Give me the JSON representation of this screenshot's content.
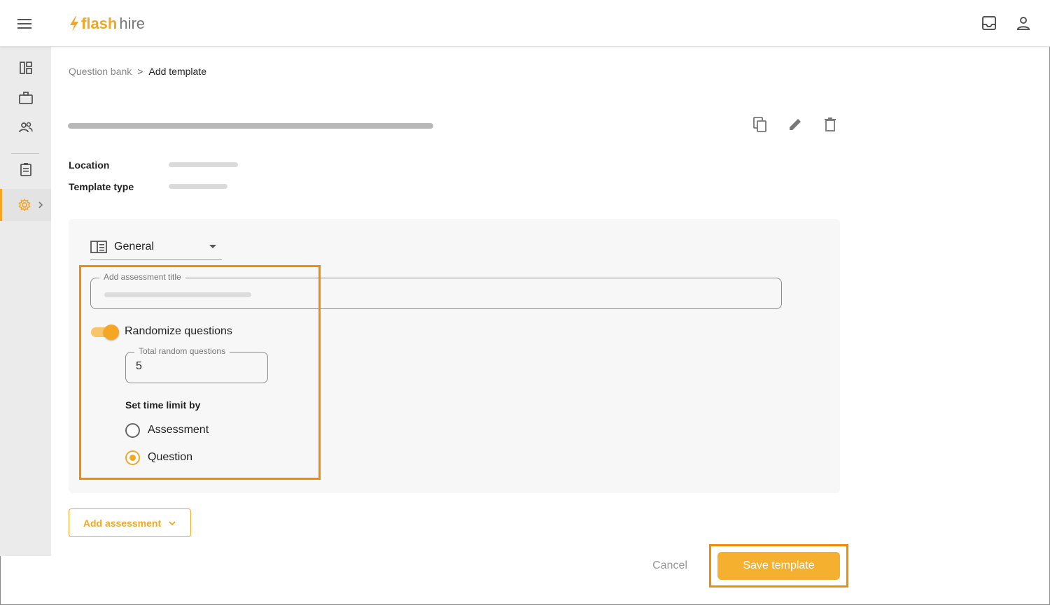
{
  "brand": {
    "logo_part1": "flash",
    "logo_part2": "hire"
  },
  "breadcrumb": {
    "parent": "Question bank",
    "separator": ">",
    "current": "Add template"
  },
  "meta": {
    "location_label": "Location",
    "template_type_label": "Template type"
  },
  "section": {
    "select_value": "General",
    "title_field_label": "Add assessment title",
    "randomize_label": "Randomize questions",
    "randomize_on": true,
    "total_random_label": "Total random questions",
    "total_random_value": "5",
    "time_limit_heading": "Set time limit by",
    "options": [
      {
        "label": "Assessment",
        "selected": false
      },
      {
        "label": "Question",
        "selected": true
      }
    ]
  },
  "actions": {
    "add_assessment": "Add assessment",
    "cancel": "Cancel",
    "save": "Save template"
  },
  "icons": {
    "top": [
      "menu-icon",
      "inbox-icon",
      "user-icon"
    ],
    "sidebar": [
      "dashboard-icon",
      "briefcase-icon",
      "people-icon",
      "clipboard-icon",
      "gear-icon"
    ],
    "title_actions": [
      "copy-icon",
      "edit-icon",
      "delete-icon"
    ]
  },
  "colors": {
    "accent": "#f5a623",
    "highlight": "#f28c00",
    "sidebar_bg": "#ebebeb"
  }
}
